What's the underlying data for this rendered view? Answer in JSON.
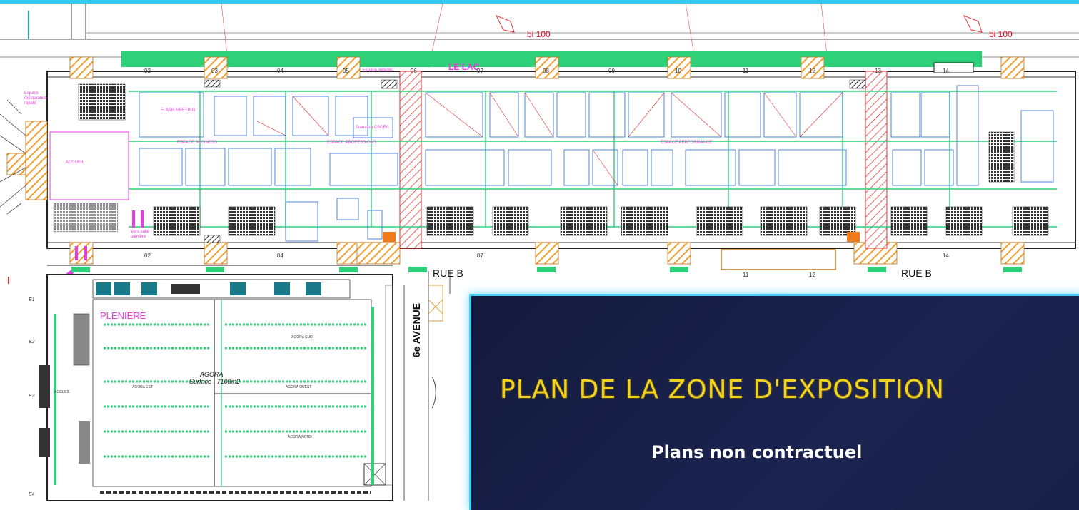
{
  "title": {
    "main": "PLAN DE LA ZONE D'EXPOSITION",
    "sub": "Plans non contractuel"
  },
  "colors": {
    "accent_border": "#3bd2ff",
    "title_yellow": "#f2d21c",
    "panel_bg": "#1b2350",
    "corridor_green": "#2fd07a",
    "zone_magenta": "#e83ce0",
    "hatch_orange": "#f0a030",
    "hatch_red": "#e03030",
    "stand_blue": "#3a78d8"
  },
  "map": {
    "lake_label": "LE LAC",
    "dimension_labels": [
      "bi 100",
      "bi 100"
    ],
    "hall_numbers_top": [
      "02",
      "03",
      "04",
      "05",
      "06",
      "07",
      "08",
      "09",
      "10",
      "11",
      "12",
      "13",
      "14"
    ],
    "hall_numbers_bottom": [
      "02",
      "04",
      "07",
      "11",
      "12",
      "14"
    ],
    "zones": {
      "accueil": "ACCUEIL",
      "espace_business": "ESPACE BUSINESS",
      "espace_professions": "ESPACE PROFESSIONS",
      "espace_performance": "ESPACE PERFORMANCE",
      "flash_meeting": "FLASH MEETING",
      "stand_csoec": "Stand du CSOEC",
      "espace_detente": "Espace détente",
      "restauration": "Espace restauration rapide",
      "vers_salle": "Vers salle plénière",
      "pleniere": "PLENIERE",
      "agora": "AGORA",
      "agora_surface": "Surface : 7100m2",
      "agora_est": "AGORA EST",
      "agora_sud": "AGORA SUD",
      "agora_ouest": "AGORA OUEST",
      "agora_nord": "AGORA NORD",
      "accueil_small": "ACCUEIL"
    },
    "roads": {
      "rue_b_left": "RUE B",
      "rue_b_right": "RUE B",
      "avenue": "6e AVENUE"
    },
    "gate_labels": [
      "E1",
      "E2",
      "E3",
      "E4"
    ]
  }
}
